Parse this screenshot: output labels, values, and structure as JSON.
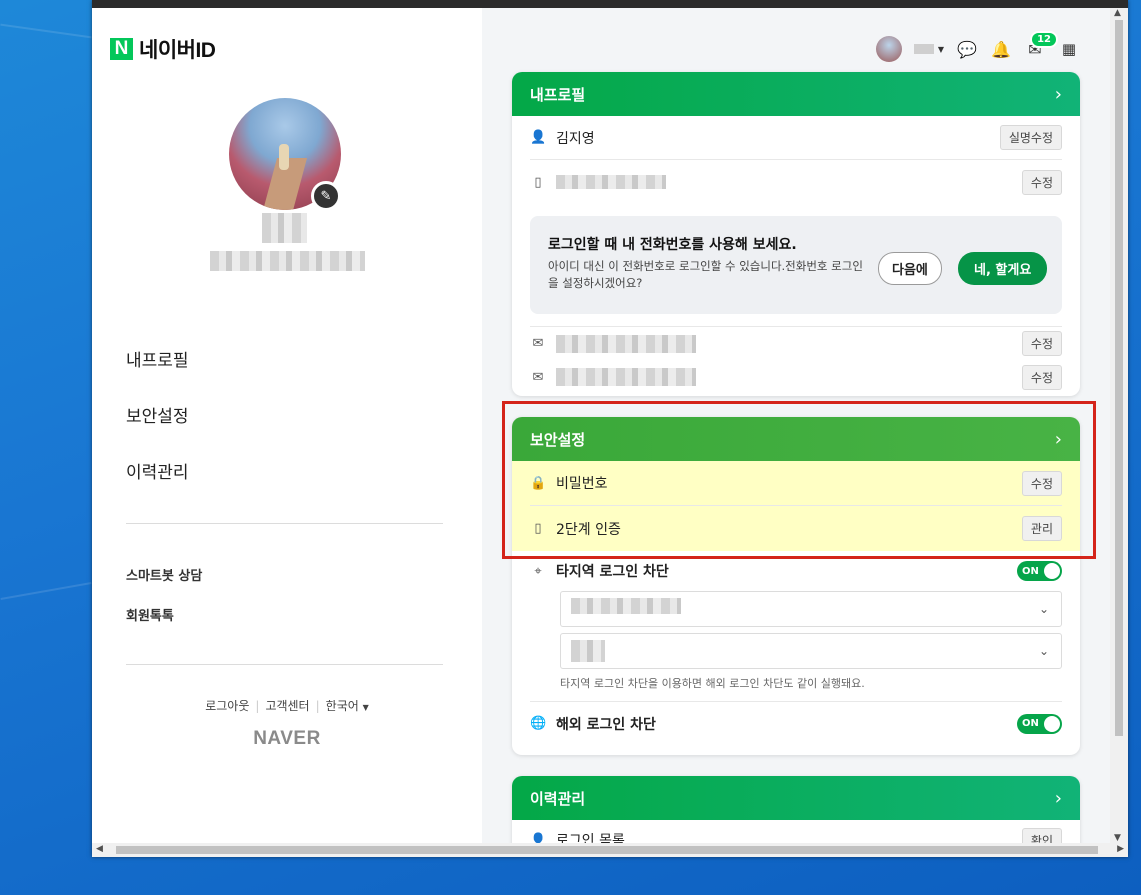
{
  "brand": {
    "logo_letter": "N",
    "logo_text": "네이버ID",
    "footer_word": "NAVER"
  },
  "left_nav": {
    "items": [
      "내프로필",
      "보안설정",
      "이력관리"
    ],
    "sub_links": [
      "스마트봇 상담",
      "회원톡톡"
    ],
    "footer": {
      "logout": "로그아웃",
      "help": "고객센터",
      "lang": "한국어"
    }
  },
  "header": {
    "mail_count": "12"
  },
  "profile_card": {
    "title": "내프로필",
    "name": "김지영",
    "name_button": "실명수정",
    "phone_button": "수정",
    "promo": {
      "title": "로그인할 때 내 전화번호를 사용해 보세요.",
      "desc": "아이디 대신 이 전화번호로 로그인할 수 있습니다.전화번호 로그인을 설정하시겠어요?",
      "later": "다음에",
      "accept": "네, 할게요"
    },
    "email_button_1": "수정",
    "email_button_2": "수정"
  },
  "security_card": {
    "title": "보안설정",
    "password_label": "비밀번호",
    "password_button": "수정",
    "twofa_label": "2단계 인증",
    "twofa_button": "관리",
    "region_block_label": "타지역 로그인 차단",
    "region_toggle": "ON",
    "region_note": "타지역 로그인 차단을 이용하면 해외 로그인 차단도 같이 실행돼요.",
    "overseas_block_label": "해외 로그인 차단",
    "overseas_toggle": "ON"
  },
  "history_card": {
    "title": "이력관리",
    "row_label": "로그인 목록",
    "row_button": "확인"
  },
  "colors": {
    "accent_green": "#03c75a",
    "highlight": "#ffffc4",
    "annotation_red": "#d4241a"
  }
}
